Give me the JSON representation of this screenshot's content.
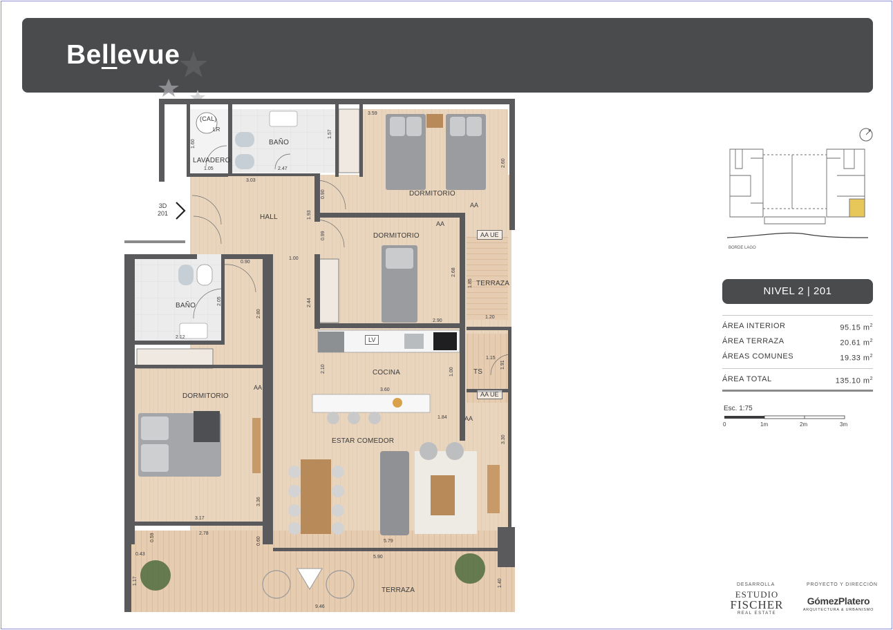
{
  "brand": {
    "name_pre": "Be",
    "name_ul": "ll",
    "name_post": "evue"
  },
  "unit": {
    "nivel": "NIVEL 2 | 201",
    "entrance_line1": "3D",
    "entrance_line2": "201"
  },
  "rooms": {
    "lavadero": "LAVADERO",
    "cal": "(CAL)",
    "lr": "LR",
    "bano_top": "BAÑO",
    "dormitorio_top": "DORMITORIO",
    "hall": "HALL",
    "dormitorio_mid": "DORMITORIO",
    "terraza_small": "TERRAZA",
    "bano_left": "BAÑO",
    "cocina": "COCINA",
    "lv": "LV",
    "ts": "TS",
    "dormitorio_left": "DORMITORIO",
    "estar_comedor": "ESTAR COMEDOR",
    "terraza_bottom": "TERRAZA"
  },
  "tags": {
    "aa": "AA",
    "aa_ue": "AA UE"
  },
  "dims": {
    "d160": "1.60",
    "d105": "1.05",
    "d247": "2.47",
    "d157": "1.57",
    "d359": "3.59",
    "d260": "2.60",
    "d303": "3.03",
    "d090a": "0.90",
    "d193": "1.93",
    "d099": "0.99",
    "d268": "2.68",
    "d290": "2.90",
    "d185": "1.85",
    "d120": "1.20",
    "d090b": "0.90",
    "d100a": "1.00",
    "d205": "2.05",
    "d280": "2.80",
    "d244": "2.44",
    "d212": "2.12",
    "d210": "2.10",
    "d100b": "1.00",
    "d360": "3.60",
    "d115": "1.15",
    "d191": "1.91",
    "d184": "1.84",
    "d330": "3.30",
    "d336": "3.36",
    "d317": "3.17",
    "d278": "2.78",
    "d059": "0.59",
    "d043": "0.43",
    "d060": "0.60",
    "d579": "5.79",
    "d590": "5.90",
    "d117": "1.17",
    "d140": "1.40",
    "d946": "9.46"
  },
  "areas": [
    {
      "label": "ÁREA INTERIOR",
      "value": "95.15 m",
      "sup": "2"
    },
    {
      "label": "ÁREA TERRAZA",
      "value": "20.61 m",
      "sup": "2"
    },
    {
      "label": "ÁREAS COMUNES",
      "value": "19.33 m",
      "sup": "2"
    }
  ],
  "total": {
    "label": "ÁREA TOTAL",
    "value": "135.10 m",
    "sup": "2"
  },
  "scale": {
    "title": "Esc. 1:75",
    "t0": "0",
    "t1": "1m",
    "t2": "2m",
    "t3": "3m"
  },
  "keyplan": {
    "caption": "BORDE LAGO"
  },
  "credits": {
    "desarrolla": "DESARROLLA",
    "fischer_l1": "ESTUDIO",
    "fischer_l2": "FISCHER",
    "fischer_l3": "REAL ESTATE",
    "proyecto": "PROYECTO Y DIRECCIÓN",
    "gomez_l1": "GómezPlatero",
    "gomez_l2": "ARQUITECTURA & URBANISMO"
  },
  "colors": {
    "header_bg": "#4a4b4d",
    "wall": "#5a5a5c",
    "wood": "#e8d3bc",
    "wood_dark": "#d9bfa2",
    "tile": "#e6e6e6",
    "keyplan_highlight": "#e8c75a"
  }
}
